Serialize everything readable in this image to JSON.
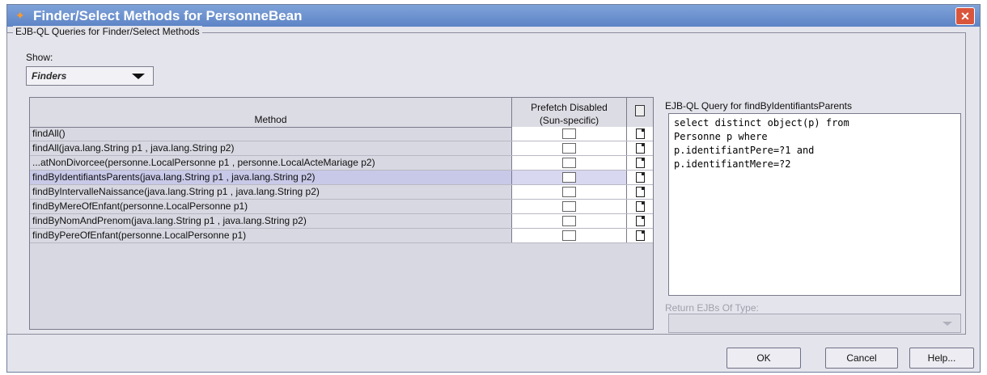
{
  "window": {
    "title": "Finder/Select Methods for PersonneBean"
  },
  "group": {
    "title": "EJB-QL Queries for Finder/Select Methods"
  },
  "show": {
    "label": "Show:",
    "selected": "Finders"
  },
  "table": {
    "headers": {
      "method": "Method",
      "prefetch_line1": "Prefetch Disabled",
      "prefetch_line2": "(Sun-specific)"
    },
    "rows": [
      {
        "method": "findAll()",
        "prefetch_disabled": false
      },
      {
        "method": "findAll(java.lang.String p1 , java.lang.String p2)",
        "prefetch_disabled": false
      },
      {
        "method": "...atNonDivorcee(personne.LocalPersonne p1 , personne.LocalActeMariage p2)",
        "prefetch_disabled": false
      },
      {
        "method": "findByIdentifiantsParents(java.lang.String p1 , java.lang.String p2)",
        "prefetch_disabled": false,
        "selected": true
      },
      {
        "method": "findByIntervalleNaissance(java.lang.String p1 , java.lang.String p2)",
        "prefetch_disabled": false
      },
      {
        "method": "findByMereOfEnfant(personne.LocalPersonne p1)",
        "prefetch_disabled": false
      },
      {
        "method": "findByNomAndPrenom(java.lang.String p1 , java.lang.String p2)",
        "prefetch_disabled": false
      },
      {
        "method": "findByPereOfEnfant(personne.LocalPersonne p1)",
        "prefetch_disabled": false
      }
    ]
  },
  "query": {
    "label": "EJB-QL Query for findByIdentifiantsParents",
    "text": "select distinct object(p) from\nPersonne p where\np.identifiantPere=?1 and\np.identifiantMere=?2"
  },
  "return_type": {
    "label": "Return EJBs Of Type:",
    "value": ""
  },
  "buttons": {
    "ok": "OK",
    "cancel": "Cancel",
    "help": "Help..."
  },
  "colors": {
    "titlebar": "#5d84c6",
    "close": "#d9563d",
    "selected_row": "#c8c8e8",
    "window_bg": "#e4e4ec"
  }
}
